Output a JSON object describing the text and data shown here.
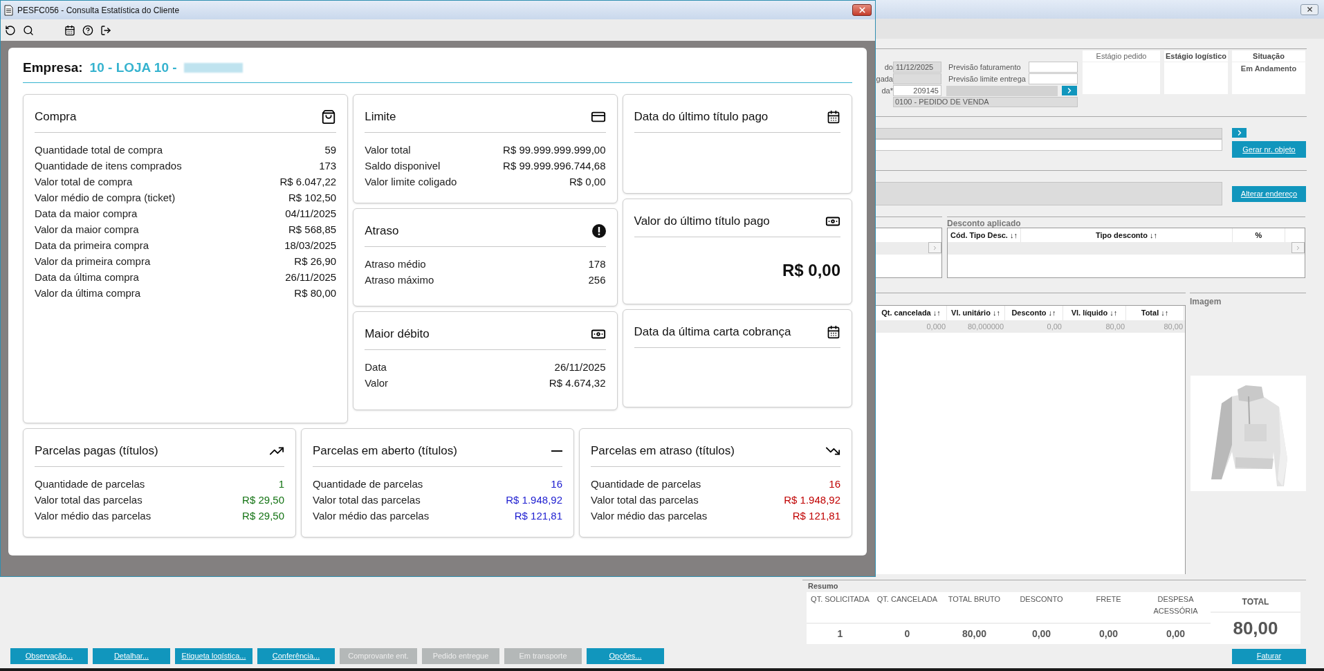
{
  "app": {
    "form": {
      "fields": [
        {
          "label": "do",
          "value": "11/12/2025",
          "kind": "readonly"
        },
        {
          "label": "gada",
          "kind": "readonly"
        },
        {
          "label": "da*",
          "value": "209145",
          "kind": "input"
        }
      ],
      "side_fields": [
        {
          "label": "Previsão faturamento"
        },
        {
          "label": "Previsão limite entrega"
        }
      ],
      "order_type": "0100 - PEDIDO DE VENDA"
    },
    "status_columns": [
      {
        "header": "Estágio pedido",
        "bold": false
      },
      {
        "header": "Estágio logístico",
        "bold": true
      },
      {
        "header": "Situação",
        "bold": true,
        "value": "Em Andamento"
      }
    ],
    "object_button": "Gerar nr. objeto",
    "address_button": "Alterar endereço",
    "discount": {
      "title": "Desconto aplicado",
      "columns": [
        "Cód. Tipo Desc. ↓↑",
        "Tipo desconto ↓↑",
        "%"
      ]
    },
    "items": {
      "columns": [
        "Qt. cancelada ↓↑",
        "Vl. unitário ↓↑",
        "Desconto ↓↑",
        "Vl. líquido ↓↑",
        "Total ↓↑"
      ],
      "rows": [
        [
          "0,000",
          "80,000000",
          "0,00",
          "80,00",
          "80,00"
        ]
      ]
    },
    "image_label": "Imagem",
    "summary": {
      "title": "Resumo",
      "columns": [
        {
          "header": "QT. SOLICITADA",
          "value": "1"
        },
        {
          "header": "QT. CANCELADA",
          "value": "0"
        },
        {
          "header": "TOTAL BRUTO",
          "value": "80,00"
        },
        {
          "header": "DESCONTO",
          "value": "0,00"
        },
        {
          "header": "FRETE",
          "value": "0,00"
        },
        {
          "header": "DESPESA ACESSÓRIA",
          "value": "0,00"
        }
      ],
      "total": {
        "header": "TOTAL",
        "value": "80,00"
      }
    },
    "invoice_button": "Faturar",
    "actions": [
      {
        "label": "Observação...",
        "disabled": false
      },
      {
        "label": "Detalhar...",
        "disabled": false
      },
      {
        "label": "Etiqueta logística...",
        "disabled": false
      },
      {
        "label": "Conferência...",
        "disabled": false
      },
      {
        "label": "Comprovante ent.",
        "disabled": true
      },
      {
        "label": "Pedido entregue",
        "disabled": true
      },
      {
        "label": "Em transporte",
        "disabled": true
      },
      {
        "label": "Opções...",
        "disabled": false
      }
    ]
  },
  "dialog": {
    "title": "PESFC056 - Consulta Estatística do Cliente",
    "company_label": "Empresa:",
    "company": "10 - LOJA 10 -",
    "columns": [
      {
        "cards": [
          {
            "kind": "rows",
            "title": "Compra",
            "rows": [
              {
                "label": "Quantidade total de compra",
                "value": "59"
              },
              {
                "label": "Quantidade de itens comprados",
                "value": "173"
              },
              {
                "label": "Valor total de compra",
                "value": "R$ 6.047,22"
              },
              {
                "label": "Valor médio de compra (ticket)",
                "value": "R$ 102,50"
              },
              {
                "label": "Data da maior compra",
                "value": "04/11/2025"
              },
              {
                "label": "Valor da maior compra",
                "value": "R$ 568,85"
              },
              {
                "label": "Data da primeira compra",
                "value": "18/03/2025"
              },
              {
                "label": "Valor da primeira compra",
                "value": "R$ 26,90"
              },
              {
                "label": "Data da última compra",
                "value": "26/11/2025"
              },
              {
                "label": "Valor da última compra",
                "value": "R$ 80,00"
              }
            ]
          }
        ]
      },
      {
        "cards": [
          {
            "kind": "rows",
            "title": "Limite",
            "rows": [
              {
                "label": "Valor total",
                "value": "R$ 99.999.999.999,00"
              },
              {
                "label": "Saldo disponivel",
                "value": "R$ 99.999.996.744,68"
              },
              {
                "label": "Valor limite coligado",
                "value": "R$ 0,00"
              }
            ]
          },
          {
            "kind": "rows",
            "title": "Atraso",
            "rows": [
              {
                "label": "Atraso médio",
                "value": "178"
              },
              {
                "label": "Atraso máximo",
                "value": "256"
              }
            ]
          },
          {
            "kind": "rows",
            "title": "Maior débito",
            "rows": [
              {
                "label": "Data",
                "value": "26/11/2025"
              },
              {
                "label": "Valor",
                "value": "R$ 4.674,32"
              }
            ]
          }
        ]
      },
      {
        "cards": [
          {
            "kind": "empty",
            "title": "Data do último título pago"
          },
          {
            "kind": "amount",
            "title": "Valor do último título pago",
            "amount": "R$ 0,00"
          },
          {
            "kind": "empty",
            "title": "Data da última carta cobrança"
          }
        ]
      }
    ],
    "installments": [
      {
        "title": "Parcelas pagas (títulos)",
        "color": "#137313",
        "rows": [
          {
            "label": "Quantidade de parcelas",
            "value": "1"
          },
          {
            "label": "Valor total das parcelas",
            "value": "R$ 29,50"
          },
          {
            "label": "Valor médio das parcelas",
            "value": "R$ 29,50"
          }
        ]
      },
      {
        "title": "Parcelas em aberto (títulos)",
        "color": "#1c1cd0",
        "rows": [
          {
            "label": "Quantidade de parcelas",
            "value": "16"
          },
          {
            "label": "Valor total das parcelas",
            "value": "R$ 1.948,92"
          },
          {
            "label": "Valor médio das parcelas",
            "value": "R$ 121,81"
          }
        ]
      },
      {
        "title": "Parcelas em atraso (títulos)",
        "color": "#c00000",
        "rows": [
          {
            "label": "Quantidade de parcelas",
            "value": "16"
          },
          {
            "label": "Valor total das parcelas",
            "value": "R$ 1.948,92"
          },
          {
            "label": "Valor médio das parcelas",
            "value": "R$ 121,81"
          }
        ]
      }
    ]
  }
}
